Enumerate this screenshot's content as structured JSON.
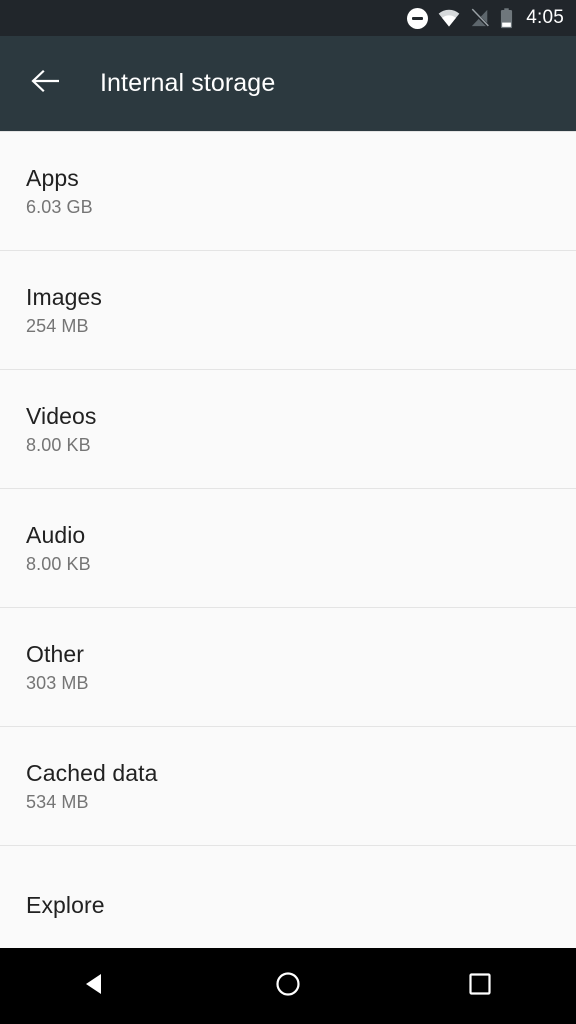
{
  "status_bar": {
    "time": "4:05",
    "icons": [
      {
        "name": "do-not-disturb-icon",
        "label": "Do not disturb"
      },
      {
        "name": "wifi-icon",
        "label": "Wi-Fi connected"
      },
      {
        "name": "no-sim-signal-icon",
        "label": "No SIM / no signal"
      },
      {
        "name": "battery-icon",
        "label": "Battery"
      }
    ],
    "colors": {
      "background": "#21262b",
      "foreground": "#ffffff",
      "dim": "#6b7379"
    }
  },
  "app_bar": {
    "title": "Internal storage",
    "back_icon": "back-arrow-icon",
    "colors": {
      "background": "#2c393f",
      "text": "#ffffff"
    }
  },
  "storage_list": {
    "items": [
      {
        "title": "Apps",
        "size": "6.03 GB"
      },
      {
        "title": "Images",
        "size": "254 MB"
      },
      {
        "title": "Videos",
        "size": "8.00 KB"
      },
      {
        "title": "Audio",
        "size": "8.00 KB"
      },
      {
        "title": "Other",
        "size": "303 MB"
      },
      {
        "title": "Cached data",
        "size": "534 MB"
      },
      {
        "title": "Explore",
        "size": ""
      }
    ],
    "colors": {
      "background": "#fafafa",
      "title": "#212121",
      "subtitle": "#757575",
      "divider": "#e4e4e4"
    }
  },
  "nav_bar": {
    "buttons": [
      {
        "name": "nav-back-button",
        "icon": "triangle-back-icon"
      },
      {
        "name": "nav-home-button",
        "icon": "circle-home-icon"
      },
      {
        "name": "nav-recents-button",
        "icon": "square-recents-icon"
      }
    ],
    "colors": {
      "background": "#000000",
      "foreground": "#ffffff"
    }
  }
}
